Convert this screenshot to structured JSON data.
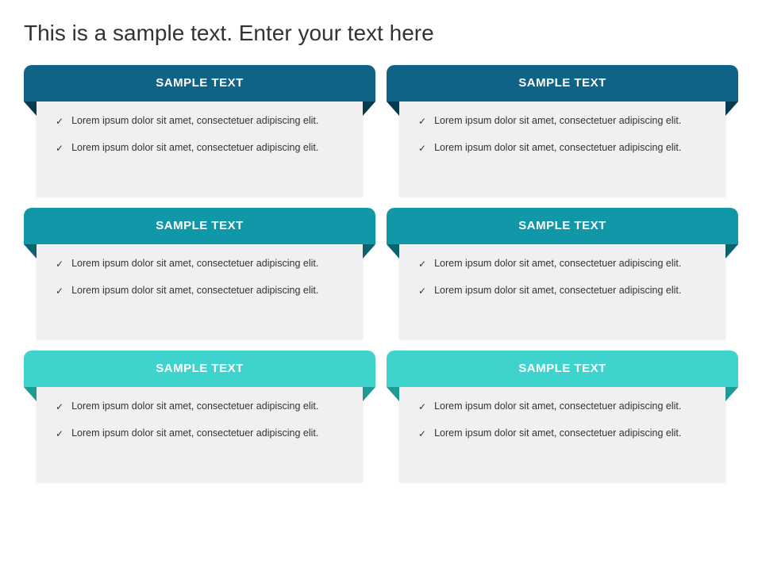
{
  "title": "This is a sample text. Enter your text here",
  "cards": [
    {
      "header": "SAMPLE TEXT",
      "bullets": [
        "Lorem ipsum dolor sit amet, consectetuer adipiscing elit.",
        "Lorem ipsum dolor sit amet, consectetuer adipiscing elit."
      ]
    },
    {
      "header": "SAMPLE TEXT",
      "bullets": [
        "Lorem ipsum dolor sit amet, consectetuer adipiscing elit.",
        "Lorem ipsum dolor sit amet, consectetuer adipiscing elit."
      ]
    },
    {
      "header": "SAMPLE TEXT",
      "bullets": [
        "Lorem ipsum dolor sit amet, consectetuer adipiscing elit.",
        "Lorem ipsum dolor sit amet, consectetuer adipiscing elit."
      ]
    },
    {
      "header": "SAMPLE TEXT",
      "bullets": [
        "Lorem ipsum dolor sit amet, consectetuer adipiscing elit.",
        "Lorem ipsum dolor sit amet, consectetuer adipiscing elit."
      ]
    },
    {
      "header": "SAMPLE TEXT",
      "bullets": [
        "Lorem ipsum dolor sit amet, consectetuer adipiscing elit.",
        "Lorem ipsum dolor sit amet, consectetuer adipiscing elit."
      ]
    },
    {
      "header": "SAMPLE TEXT",
      "bullets": [
        "Lorem ipsum dolor sit amet, consectetuer adipiscing elit.",
        "Lorem ipsum dolor sit amet, consectetuer adipiscing elit."
      ]
    }
  ]
}
